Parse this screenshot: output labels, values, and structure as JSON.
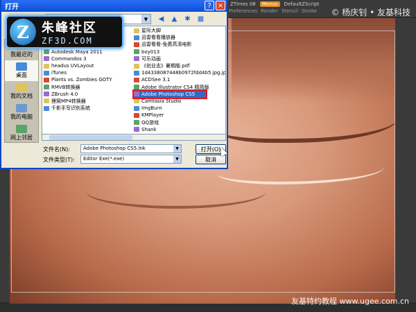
{
  "zbrush": {
    "menus": [
      "ZTimes 08",
      "Menus",
      "DefaultZScript"
    ],
    "submenus": [
      "Preferences",
      "Render",
      "Stencil",
      "Stroke"
    ],
    "watermark_top": "© 杨庆钊 • 友基科技",
    "watermark_bottom": "友基特约教程  www.ugee.com.cn"
  },
  "logo": {
    "cn": "朱峰社区",
    "en": "ZF3D.COM",
    "badge": "Z"
  },
  "dialog": {
    "title": "打开",
    "lookin_label": "查",
    "titlebar_buttons": [
      "?",
      "×"
    ],
    "nav_icons": [
      "back-icon",
      "folder-up-icon",
      "new-folder-icon",
      "view-menu-icon"
    ],
    "places": [
      {
        "label": "我最近的",
        "icon": "recent-icon"
      },
      {
        "label": "桌面",
        "icon": "desktop-icon"
      },
      {
        "label": "我的文档",
        "icon": "documents-icon"
      },
      {
        "label": "我的电脑",
        "icon": "computer-icon"
      },
      {
        "label": "网上邻居",
        "icon": "network-icon"
      }
    ],
    "files_col1": [
      "《星际争霸 II》",
      "Adobe Reader 8",
      "Autodesk Maya 2009",
      "Autodesk Maya 2011",
      "Commandos 3",
      "headus UVLayout",
      "iTunes",
      "Plants vs. Zombies GOTY",
      "RMVB转换器",
      "ZBrush 4.0",
      "狸窝MP4转换器",
      "千影手写识别系统"
    ],
    "files_col2": [
      "星际大脚",
      "迅雷看看播放器",
      "迅雷看看-免费高清电影",
      "boy013",
      "可乐动画",
      "《创业志》暑期版.pdf",
      "1d4338087448b0972fdd4b5.jpg.jpg",
      "ACDSee 3.1",
      "Adobe Illustrator CS4 精简版",
      "Adobe Photoshop CS5",
      "Camtasia Studio",
      "ImgBurn",
      "KMPlayer",
      "QQ游戏",
      "Shank"
    ],
    "selected_file": "Adobe Photoshop CS5",
    "filename_label": "文件名(N):",
    "filename_value": "Adobe Photoshop CS5.lnk",
    "filetype_label": "文件类型(T):",
    "filetype_value": "Editor Exe(*.exe)",
    "open_button": "打开(O)",
    "cancel_button": "取消"
  }
}
